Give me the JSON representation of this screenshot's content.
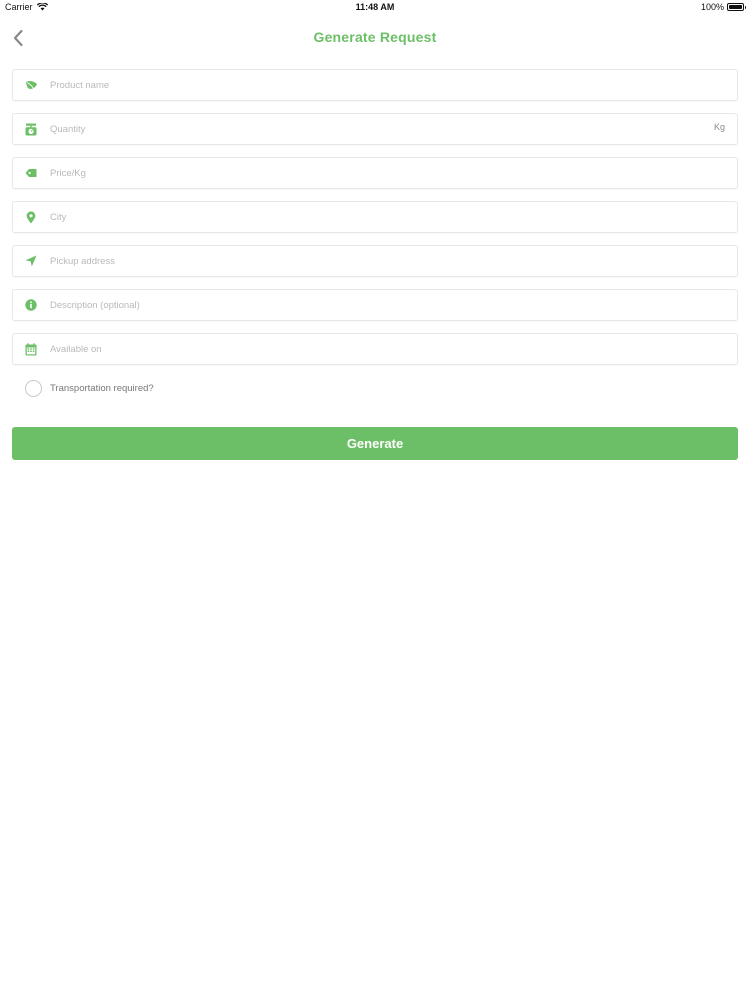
{
  "status_bar": {
    "carrier": "Carrier",
    "time": "11:48 AM",
    "battery": "100%"
  },
  "header": {
    "title": "Generate Request",
    "back_icon": "chevron-left-icon"
  },
  "theme": {
    "accent": "#6dbf67"
  },
  "form": {
    "fields": [
      {
        "placeholder": "Product name",
        "icon": "leaf-icon",
        "suffix": ""
      },
      {
        "placeholder": "Quantity",
        "icon": "scale-icon",
        "suffix": "Kg"
      },
      {
        "placeholder": "Price/Kg",
        "icon": "price-tag-icon",
        "suffix": ""
      },
      {
        "placeholder": "City",
        "icon": "map-pin-icon",
        "suffix": ""
      },
      {
        "placeholder": "Pickup address",
        "icon": "navigation-arrow-icon",
        "suffix": ""
      },
      {
        "placeholder": "Description (optional)",
        "icon": "info-icon",
        "suffix": ""
      },
      {
        "placeholder": "Available on",
        "icon": "calendar-icon",
        "suffix": ""
      }
    ],
    "transport_checkbox_label": "Transportation required?",
    "submit_label": "Generate"
  }
}
